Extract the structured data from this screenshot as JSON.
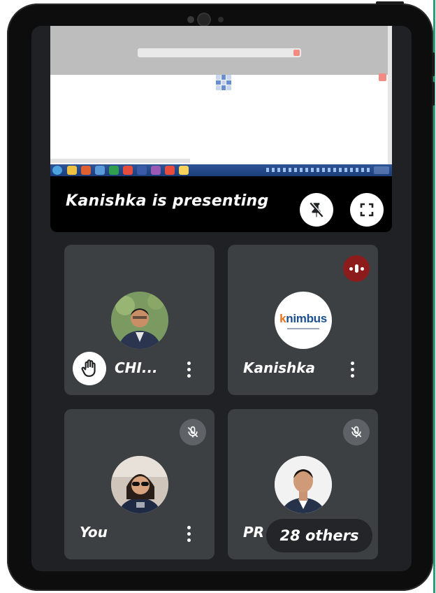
{
  "presenter": {
    "label": "Kanishka is presenting",
    "unpin_icon": "pin-off-icon",
    "fullscreen_icon": "fullscreen-icon"
  },
  "participants": [
    {
      "name": "CHI...",
      "hand_raised": true,
      "muted": false
    },
    {
      "name": "Kanishka",
      "speaking": true,
      "logo_text": "nimbus",
      "logo_prefix": "k"
    },
    {
      "name": "You",
      "muted": true
    },
    {
      "name": "PR",
      "muted": true
    }
  ],
  "others_label": "28 others",
  "colors": {
    "screen_bg": "#202124",
    "tile_bg": "#3c4043",
    "speaking_red": "#8c1c1c",
    "mute_gray": "#5f6368",
    "accent_line": "#2e9e74"
  }
}
